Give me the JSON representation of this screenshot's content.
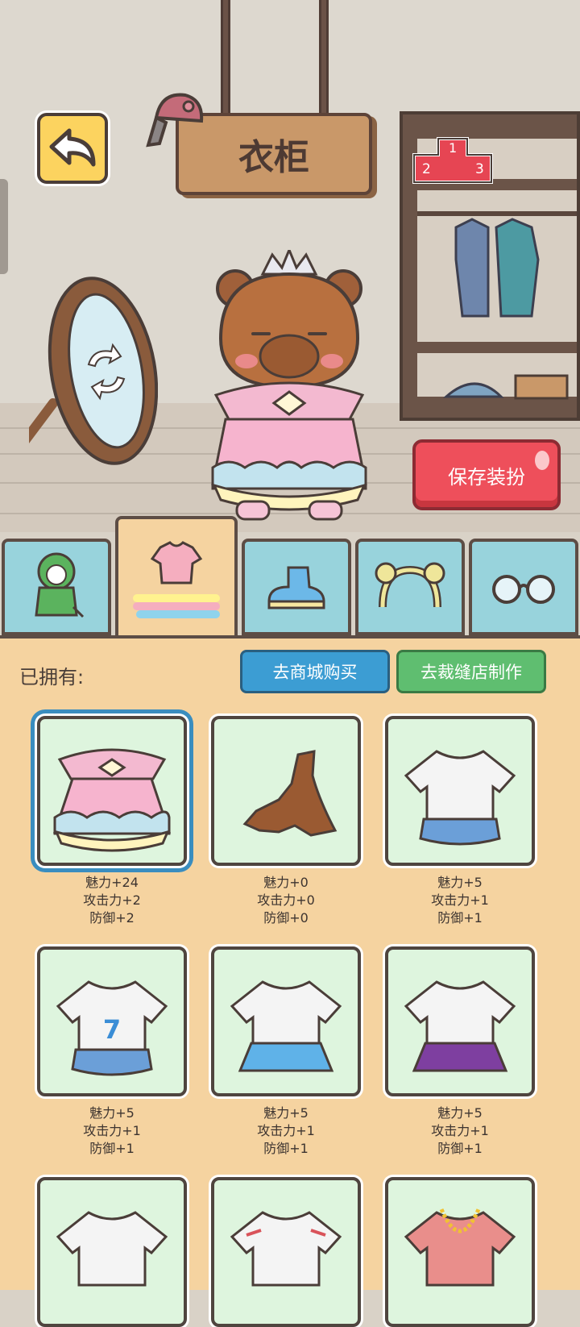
{
  "header": {
    "title": "衣柜"
  },
  "icons": {
    "back": "back-arrow-icon",
    "ranking": "ranking-podium-icon",
    "mirror": "mirror-rotate-icon",
    "tabs": [
      "costume-icon",
      "clothes-icon",
      "shoes-icon",
      "headwear-icon",
      "glasses-icon"
    ]
  },
  "ranking": {
    "first": "1",
    "second": "2",
    "third": "3"
  },
  "save_button": {
    "label": "保存装扮"
  },
  "panel": {
    "owned_label": "已拥有:",
    "shop_button": "去商城购买",
    "tailor_button": "去裁缝店制作"
  },
  "items": [
    {
      "name": "princess-dress",
      "charm": "魅力+24",
      "attack": "攻击力+2",
      "defense": "防御+2"
    },
    {
      "name": "torn-rag",
      "charm": "魅力+0",
      "attack": "攻击力+0",
      "defense": "防御+0"
    },
    {
      "name": "white-tee-blue-shorts",
      "charm": "魅力+5",
      "attack": "攻击力+1",
      "defense": "防御+1"
    },
    {
      "name": "sport-tee-7",
      "charm": "魅力+5",
      "attack": "攻击力+1",
      "defense": "防御+1"
    },
    {
      "name": "tee-blue-skirt",
      "charm": "魅力+5",
      "attack": "攻击力+1",
      "defense": "防御+1"
    },
    {
      "name": "tee-purple-skirt",
      "charm": "魅力+5",
      "attack": "攻击力+1",
      "defense": "防御+1"
    }
  ],
  "colors": {
    "accent_blue": "#3c9dd3",
    "accent_green": "#5fbe70",
    "save_red": "#ee4f5b",
    "panel_bg": "#f5d3a0",
    "card_bg": "#def5de"
  }
}
